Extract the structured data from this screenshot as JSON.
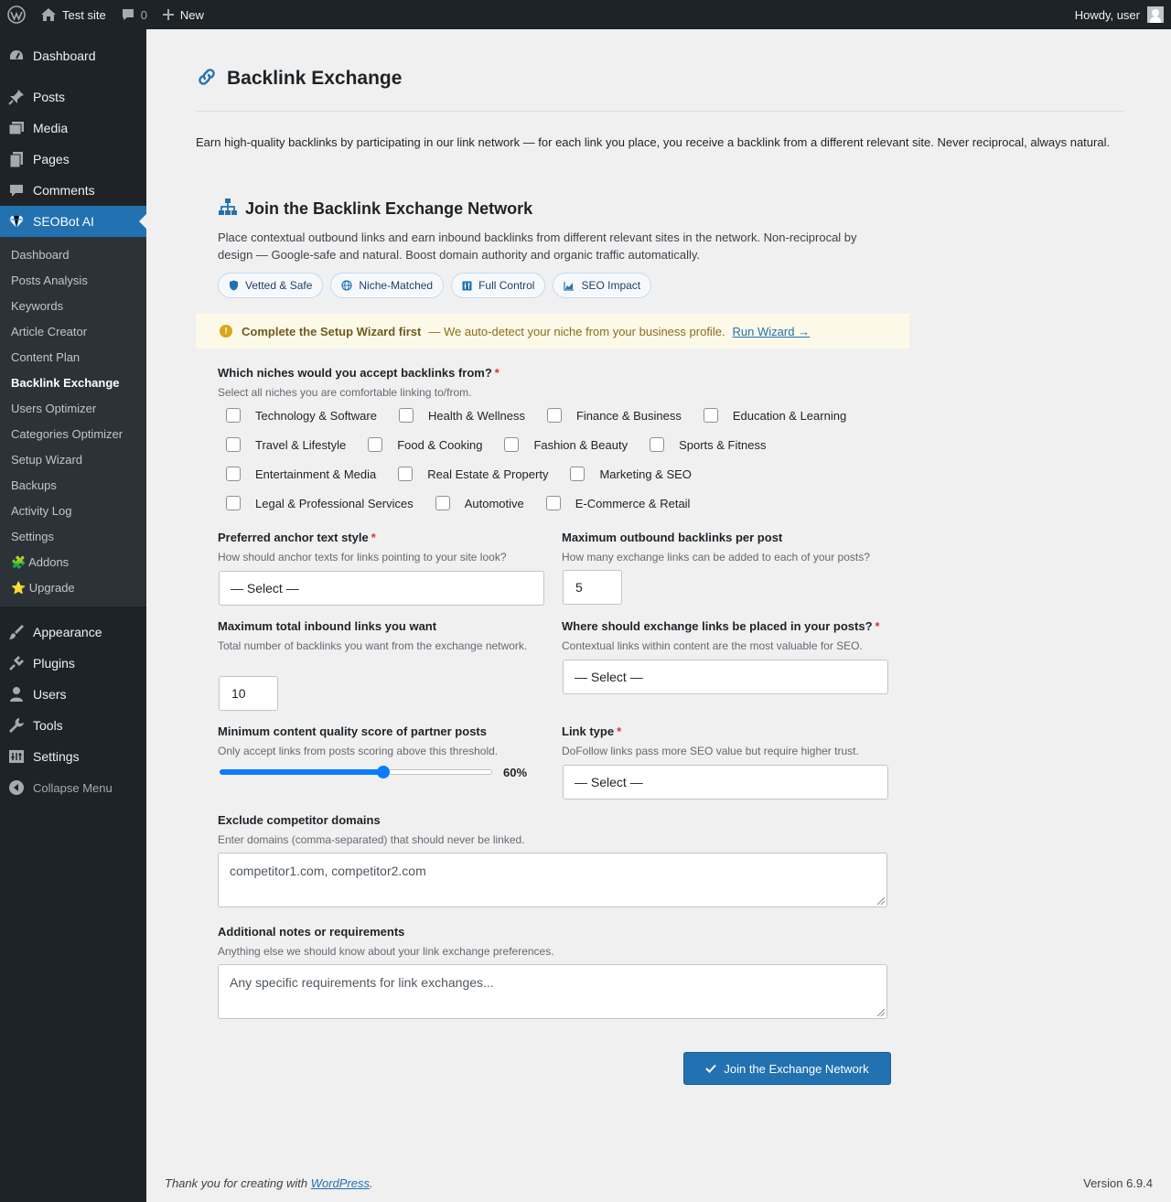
{
  "adminbar": {
    "site_name": "Test site",
    "comments_count": "0",
    "new_label": "New",
    "howdy": "Howdy, user"
  },
  "sidebar": {
    "top_items": [
      {
        "label": "Dashboard",
        "icon": "dashboard-icon"
      },
      {
        "label": "Posts",
        "icon": "pin-icon"
      },
      {
        "label": "Media",
        "icon": "media-icon"
      },
      {
        "label": "Pages",
        "icon": "pages-icon"
      },
      {
        "label": "Comments",
        "icon": "comment-icon"
      },
      {
        "label": "SEOBot AI",
        "icon": "diamond-icon"
      }
    ],
    "sub_items": [
      "Dashboard",
      "Posts Analysis",
      "Keywords",
      "Article Creator",
      "Content Plan",
      "Backlink Exchange",
      "Users Optimizer",
      "Categories Optimizer",
      "Setup Wizard",
      "Backups",
      "Activity Log",
      "Settings",
      "🧩 Addons",
      "⭐ Upgrade"
    ],
    "current_sub": "Backlink Exchange",
    "bottom_items": [
      {
        "label": "Appearance",
        "icon": "brush-icon"
      },
      {
        "label": "Plugins",
        "icon": "plug-icon"
      },
      {
        "label": "Users",
        "icon": "user-icon"
      },
      {
        "label": "Tools",
        "icon": "wrench-icon"
      },
      {
        "label": "Settings",
        "icon": "settings-icon"
      }
    ],
    "collapse_label": "Collapse Menu"
  },
  "page": {
    "title": "Backlink Exchange",
    "intro": "Earn high-quality backlinks by participating in our link network — for each link you place, you receive a backlink from a different relevant site. Never reciprocal, always natural."
  },
  "card": {
    "title": "Join the Backlink Exchange Network",
    "description": "Place contextual outbound links and earn inbound backlinks from different relevant sites in the network. Non-reciprocal by design — Google-safe and natural. Boost domain authority and organic traffic automatically.",
    "pills": [
      {
        "label": "Vetted & Safe",
        "icon": "shield-icon"
      },
      {
        "label": "Niche-Matched",
        "icon": "globe-icon"
      },
      {
        "label": "Full Control",
        "icon": "sliders-icon"
      },
      {
        "label": "SEO Impact",
        "icon": "chart-icon"
      }
    ]
  },
  "notice": {
    "bold": "Complete the Setup Wizard first",
    "text": "— We auto-detect your niche from your business profile.",
    "link": "Run Wizard →"
  },
  "form": {
    "niches": {
      "label": "Which niches would you accept backlinks from?",
      "required": "*",
      "help": "Select all niches you are comfortable linking to/from.",
      "rows": [
        [
          "Technology & Software",
          "Health & Wellness",
          "Finance & Business",
          "Education & Learning"
        ],
        [
          "Travel & Lifestyle",
          "Food & Cooking",
          "Fashion & Beauty",
          "Sports & Fitness"
        ],
        [
          "Entertainment & Media",
          "Real Estate & Property",
          "Marketing & SEO"
        ],
        [
          "Legal & Professional Services",
          "Automotive",
          "E-Commerce & Retail"
        ]
      ]
    },
    "anchor": {
      "label": "Preferred anchor text style",
      "required": "*",
      "help": "How should anchor texts for links pointing to your site look?",
      "value": "— Select —"
    },
    "max_outbound": {
      "label": "Maximum outbound backlinks per post",
      "help": "How many exchange links can be added to each of your posts?",
      "value": "5"
    },
    "max_inbound": {
      "label": "Maximum total inbound links you want",
      "help": "Total number of backlinks you want from the exchange network.",
      "value": "10"
    },
    "placement": {
      "label": "Where should exchange links be placed in your posts?",
      "required": "*",
      "help": "Contextual links within content are the most valuable for SEO.",
      "value": "— Select —"
    },
    "quality": {
      "label": "Minimum content quality score of partner posts",
      "help": "Only accept links from posts scoring above this threshold.",
      "value_label": "60%",
      "value": 60,
      "max": 100
    },
    "link_type": {
      "label": "Link type",
      "required": "*",
      "help": "DoFollow links pass more SEO value but require higher trust.",
      "value": "— Select —"
    },
    "exclude": {
      "label": "Exclude competitor domains",
      "help": "Enter domains (comma-separated) that should never be linked.",
      "placeholder": "competitor1.com, competitor2.com"
    },
    "notes": {
      "label": "Additional notes or requirements",
      "help": "Anything else we should know about your link exchange preferences.",
      "placeholder": "Any specific requirements for link exchanges..."
    },
    "submit_label": "Join the Exchange Network"
  },
  "footer": {
    "thanks_prefix": "Thank you for creating with ",
    "thanks_link": "WordPress",
    "thanks_suffix": ".",
    "version": "Version 6.9.4"
  },
  "colors": {
    "accent": "#2271b1",
    "admin_dark": "#1d2327",
    "required": "#d63638",
    "notice_bg": "#fcf9e8",
    "slider": "#0a7cff"
  }
}
